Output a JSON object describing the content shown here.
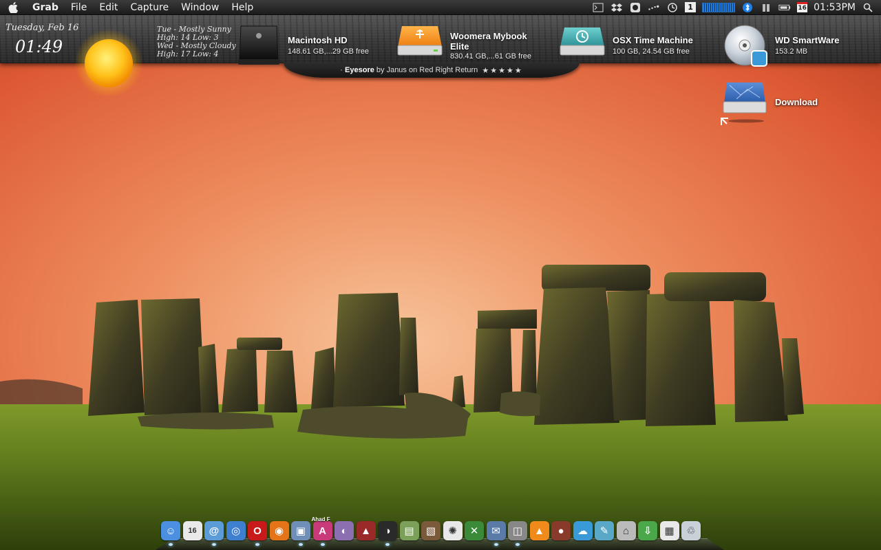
{
  "menubar": {
    "app_name": "Grab",
    "menus": [
      "File",
      "Edit",
      "Capture",
      "Window",
      "Help"
    ],
    "status_icons": [
      "terminal-icon",
      "dropbox-icon",
      "adium-icon",
      "wifi-signal-icon",
      "time-machine-icon",
      "spaces-icon",
      "network-meter-icon",
      "bluetooth-icon",
      "volume-icon",
      "battery-icon"
    ],
    "spaces_number": "1",
    "calendar_day": "16",
    "clock": "01:53PM"
  },
  "weather": {
    "date": "Tuesday, Feb 16",
    "time": "01:49",
    "forecast": [
      {
        "line1": "Tue - Mostly Sunny",
        "line2": "High: 14 Low: 3"
      },
      {
        "line1": "Wed - Mostly Cloudy",
        "line2": "High: 17 Low: 4"
      }
    ]
  },
  "credit": {
    "theme": "Eyesore",
    "rest": " by Janus on Red Right Return  ",
    "stars": "★★★★★"
  },
  "drives": [
    {
      "name": "Macintosh HD",
      "info": "148.61 GB,...29 GB free",
      "icon": "hard-drive-icon"
    },
    {
      "name": "Woomera Mybook",
      "name2": "Elite",
      "info": "830.41 GB,...61 GB free",
      "icon": "usb-drive-icon"
    },
    {
      "name": "OSX Time Machine",
      "info": "100 GB, 24.54 GB free",
      "icon": "time-machine-drive-icon"
    },
    {
      "name": "WD SmartWare",
      "info": "153.2 MB",
      "icon": "cd-drive-icon"
    }
  ],
  "desktop_items": [
    {
      "name": "Download",
      "icon": "folder-alias-icon"
    }
  ],
  "dock": {
    "items": [
      {
        "app": "finder",
        "glyph": "☺",
        "color": "#4a8fe0",
        "running": true
      },
      {
        "app": "ical",
        "glyph": "16",
        "color": "#e9e9e9",
        "running": false
      },
      {
        "app": "mail",
        "glyph": "@",
        "color": "#5a9bd8",
        "running": true
      },
      {
        "app": "safari",
        "glyph": "◎",
        "color": "#3f7fcf",
        "running": false
      },
      {
        "app": "opera",
        "glyph": "O",
        "color": "#c81a1a",
        "running": true
      },
      {
        "app": "firefox",
        "glyph": "◉",
        "color": "#e57418",
        "running": false
      },
      {
        "app": "preview",
        "glyph": "▣",
        "color": "#6f8fb8",
        "running": true
      },
      {
        "app": "ahad",
        "glyph": "A",
        "color": "#c83a7a",
        "running": true,
        "badge": "Ahad F"
      },
      {
        "app": "tor",
        "glyph": "◐",
        "color": "#8b6fb0",
        "running": false
      },
      {
        "app": "utility",
        "glyph": "▲",
        "color": "#9a2a2a",
        "running": false
      },
      {
        "app": "cinema",
        "glyph": "◑",
        "color": "#2a2a2a",
        "running": true
      },
      {
        "app": "installer",
        "glyph": "▤",
        "color": "#7aa05a",
        "running": false
      },
      {
        "app": "iphoto",
        "glyph": "▧",
        "color": "#7a5a3a",
        "running": false
      },
      {
        "app": "picasa",
        "glyph": "✺",
        "color": "#e8e8e8",
        "running": false
      },
      {
        "app": "keepassx",
        "glyph": "✕",
        "color": "#3a8a3a",
        "running": false
      },
      {
        "app": "imagecapture",
        "glyph": "✉",
        "color": "#5a7aa8",
        "running": true
      },
      {
        "app": "grab",
        "glyph": "◫",
        "color": "#888888",
        "running": true
      },
      {
        "app": "vlc",
        "glyph": "▲",
        "color": "#f08a1a",
        "running": false
      },
      {
        "app": "domo",
        "glyph": "●",
        "color": "#8a3a2a",
        "running": false
      },
      {
        "app": "coda",
        "glyph": "☁",
        "color": "#3a9ad8",
        "running": false
      },
      {
        "app": "textedit",
        "glyph": "✎",
        "color": "#5aa8c8",
        "running": false
      },
      {
        "app": "home",
        "glyph": "⌂",
        "color": "#bbbbbb",
        "running": false
      },
      {
        "app": "downloads",
        "glyph": "⇩",
        "color": "#4aa84a",
        "running": false
      },
      {
        "app": "documents",
        "glyph": "▦",
        "color": "#e8e8e8",
        "running": false
      },
      {
        "app": "trash",
        "glyph": "♲",
        "color": "#c8d0d8",
        "running": false
      }
    ]
  }
}
